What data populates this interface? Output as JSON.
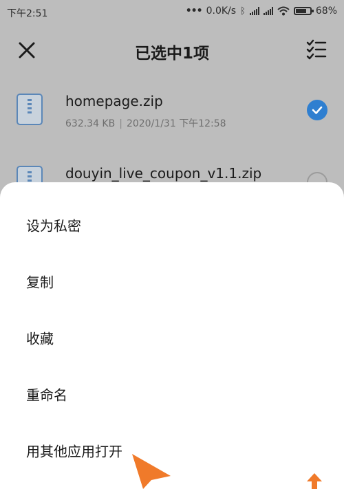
{
  "status_bar": {
    "time": "下午2:51",
    "net_speed": "0.0K/s",
    "battery": "68%",
    "battery_level": 0.68
  },
  "header": {
    "title": "已选中1项",
    "close_icon": "close-icon",
    "select_all_icon": "checklist-icon"
  },
  "files": [
    {
      "name": "homepage.zip",
      "size": "632.34 KB",
      "separator": "|",
      "date": "2020/1/31 下午12:58",
      "selected": true
    },
    {
      "name": "douyin_live_coupon_v1.1.zip",
      "selected": false
    }
  ],
  "menu": {
    "items": [
      {
        "label": "设为私密"
      },
      {
        "label": "复制"
      },
      {
        "label": "收藏"
      },
      {
        "label": "重命名"
      },
      {
        "label": "用其他应用打开"
      }
    ]
  },
  "colors": {
    "accent": "#2f7fd0",
    "overlay": "#bdbdbd",
    "annotation_arrow": "#f07a2a"
  }
}
